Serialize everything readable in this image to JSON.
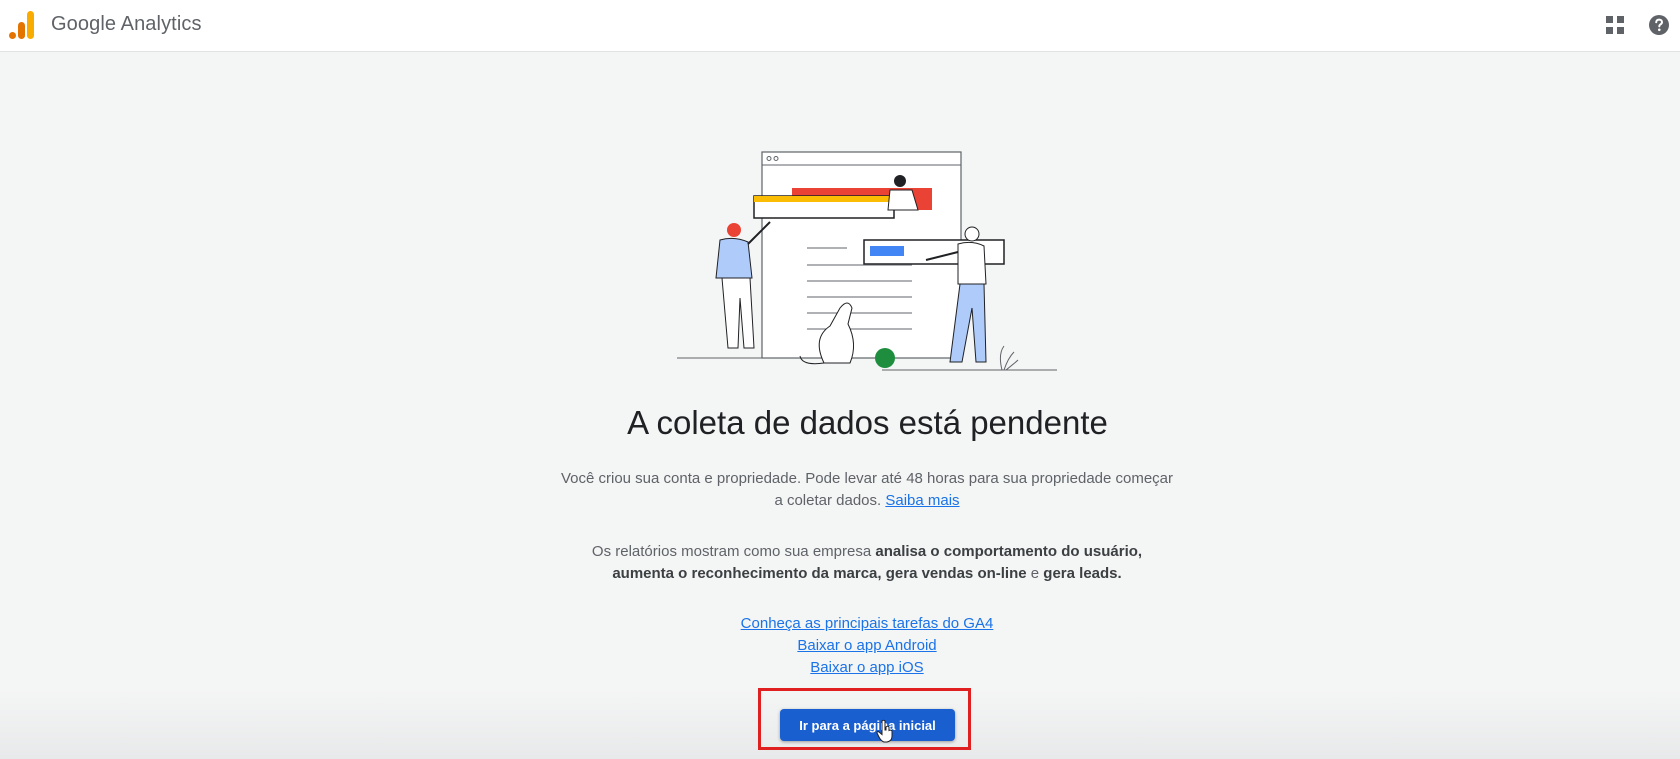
{
  "header": {
    "app_title": "Google Analytics",
    "logo_icon": "google-analytics-logo",
    "apps_icon": "apps-grid-icon",
    "help_icon": "help-circle-icon"
  },
  "main": {
    "headline": "A coleta de dados está pendente",
    "paragraph1_text": "Você criou sua conta e propriedade. Pode levar até 48 horas para sua propriedade começar a coletar dados.",
    "paragraph1_link": "Saiba mais",
    "paragraph2": {
      "part1": "Os relatórios mostram como sua empresa ",
      "bold1": "analisa o comportamento do usuário, aumenta o reconhecimento da marca, gera vendas on-line",
      "part2": " e ",
      "bold2": "gera leads."
    },
    "links": [
      "Conheça as principais tarefas do GA4",
      "Baixar o app Android",
      "Baixar o app iOS"
    ],
    "primary_button": "Ir para a página inicial"
  },
  "colors": {
    "accent": "#1a5fcf",
    "link": "#1a73e8",
    "highlight": "#e02020",
    "logo_orange": "#f9ab00",
    "logo_dark_orange": "#e37400"
  }
}
